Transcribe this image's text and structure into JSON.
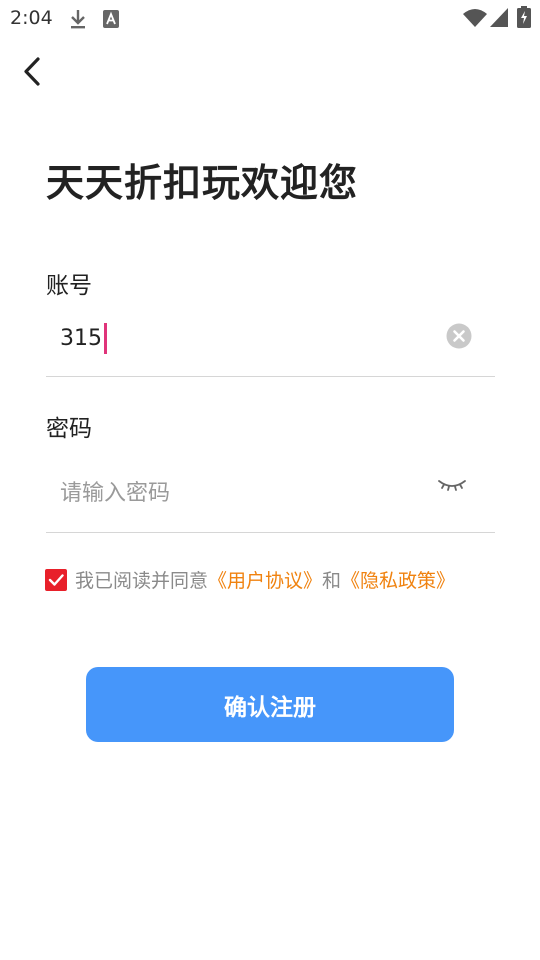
{
  "status_bar": {
    "time": "2:04",
    "icons": [
      "download-icon",
      "a-icon",
      "wifi-icon",
      "signal-icon",
      "battery-charging-icon"
    ]
  },
  "header": {
    "back_icon": "chevron-left-icon"
  },
  "title": "天天折扣玩欢迎您",
  "account": {
    "label": "账号",
    "value": "315",
    "clear_icon": "clear-circle-icon"
  },
  "password": {
    "label": "密码",
    "placeholder": "请输入密码",
    "visibility_icon": "eye-closed-icon"
  },
  "agreement": {
    "checked": true,
    "text_prefix": "我已阅读并同意",
    "user_agreement": "《用户协议》",
    "connector": "和",
    "privacy_policy": "《隐私政策》",
    "link_color": "#f0820f",
    "checkbox_color": "#e8202a"
  },
  "submit": {
    "label": "确认注册",
    "color": "#4696fa"
  }
}
